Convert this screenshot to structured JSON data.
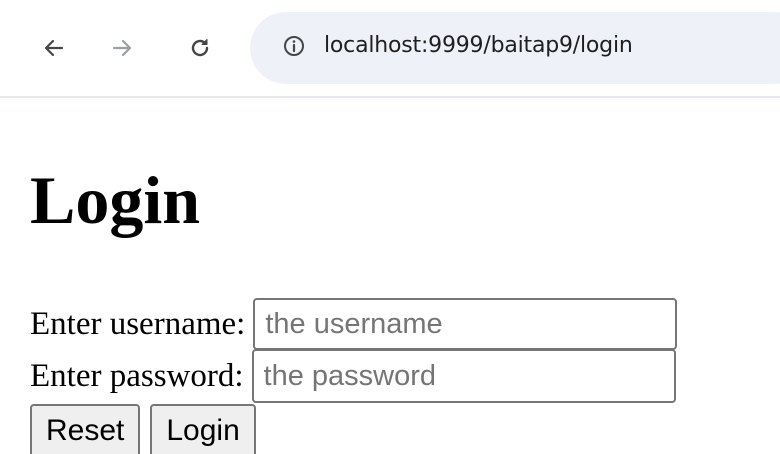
{
  "browser": {
    "url": "localhost:9999/baitap9/login",
    "icons": {
      "back": "back-arrow-icon",
      "forward": "forward-arrow-icon",
      "reload": "reload-icon",
      "site_info": "info-icon"
    },
    "colors": {
      "omnibox_bg": "#eef1f8",
      "icon_active": "#444746",
      "icon_disabled": "#9aa0a6"
    }
  },
  "page": {
    "title": "Login",
    "form": {
      "username_label": "Enter username:",
      "username_placeholder": "the username",
      "username_value": "",
      "password_label": "Enter password:",
      "password_placeholder": "the password",
      "password_value": "",
      "reset_label": "Reset",
      "login_label": "Login"
    }
  }
}
